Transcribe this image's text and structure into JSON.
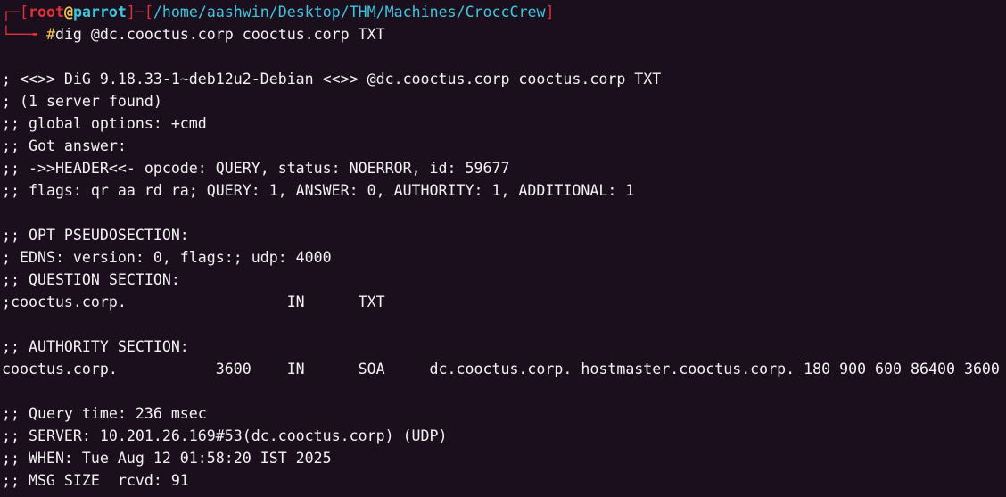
{
  "prompt": {
    "corner_top": "┌─",
    "bracket_open": "[",
    "user": "root",
    "at": "@",
    "host": "parrot",
    "bracket_close": "]",
    "dash": "─",
    "path_open": "[",
    "path": "/home/aashwin/Desktop/THM/Machines/CroccCrew",
    "path_close": "]",
    "corner_bottom": "└──╼ ",
    "symbol": "#",
    "command": "dig @dc.cooctus.corp cooctus.corp TXT"
  },
  "output": [
    "",
    "; <<>> DiG 9.18.33-1~deb12u2-Debian <<>> @dc.cooctus.corp cooctus.corp TXT",
    "; (1 server found)",
    ";; global options: +cmd",
    ";; Got answer:",
    ";; ->>HEADER<<- opcode: QUERY, status: NOERROR, id: 59677",
    ";; flags: qr aa rd ra; QUERY: 1, ANSWER: 0, AUTHORITY: 1, ADDITIONAL: 1",
    "",
    ";; OPT PSEUDOSECTION:",
    "; EDNS: version: 0, flags:; udp: 4000",
    ";; QUESTION SECTION:",
    ";cooctus.corp.                  IN      TXT",
    "",
    ";; AUTHORITY SECTION:",
    "cooctus.corp.           3600    IN      SOA     dc.cooctus.corp. hostmaster.cooctus.corp. 180 900 600 86400 3600",
    "",
    ";; Query time: 236 msec",
    ";; SERVER: 10.201.26.169#53(dc.cooctus.corp) (UDP)",
    ";; WHEN: Tue Aug 12 01:58:20 IST 2025",
    ";; MSG SIZE  rcvd: 91"
  ]
}
